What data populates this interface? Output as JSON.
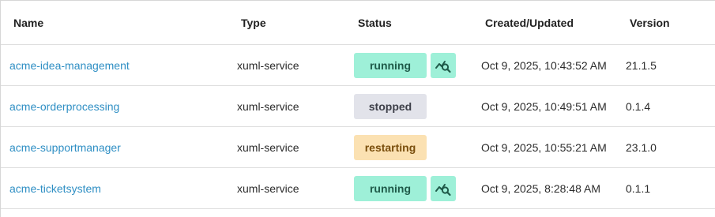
{
  "columns": {
    "name": "Name",
    "type": "Type",
    "status": "Status",
    "created": "Created/Updated",
    "version": "Version"
  },
  "rows": [
    {
      "name": "acme-idea-management",
      "type": "xuml-service",
      "status": "running",
      "created": "Oct 9, 2025, 10:43:52 AM",
      "version": "21.1.5"
    },
    {
      "name": "acme-orderprocessing",
      "type": "xuml-service",
      "status": "stopped",
      "created": "Oct 9, 2025, 10:49:51 AM",
      "version": "0.1.4"
    },
    {
      "name": "acme-supportmanager",
      "type": "xuml-service",
      "status": "restarting",
      "created": "Oct 9, 2025, 10:55:21 AM",
      "version": "23.1.0"
    },
    {
      "name": "acme-ticketsystem",
      "type": "xuml-service",
      "status": "running",
      "created": "Oct 9, 2025, 8:28:48 AM",
      "version": "0.1.1"
    }
  ],
  "icons": {
    "monitor": "chart-search-icon"
  },
  "colors": {
    "link": "#2f8fc4",
    "running": "#9ef0d8",
    "stopped": "#e2e3ea",
    "restarting": "#fbe1b2"
  }
}
